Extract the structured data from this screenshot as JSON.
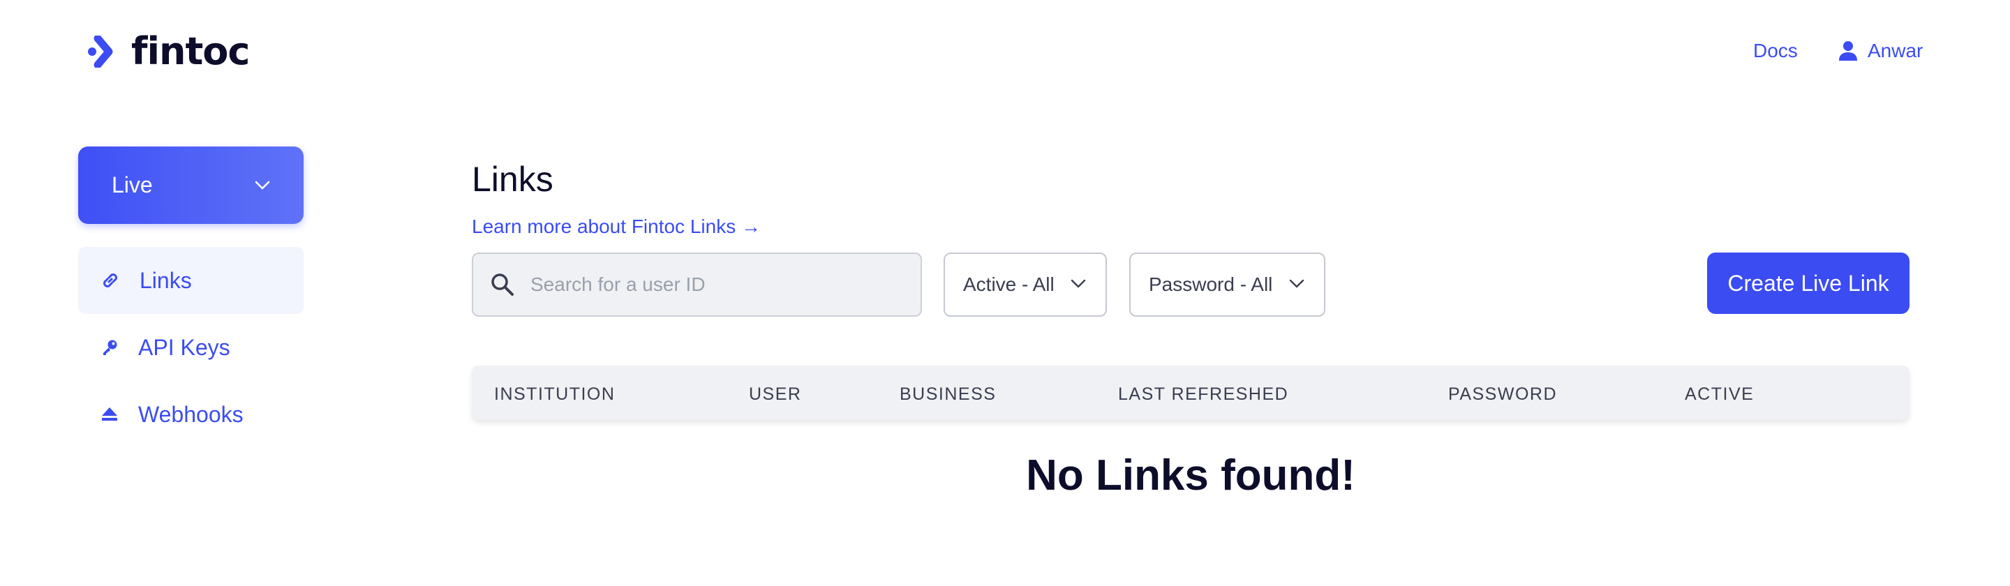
{
  "header": {
    "brand": "fintoc",
    "docs_label": "Docs",
    "user_name": "Anwar"
  },
  "sidebar": {
    "environment": "Live",
    "items": [
      {
        "label": "Links",
        "icon": "link-icon",
        "active": true
      },
      {
        "label": "API Keys",
        "icon": "key-icon",
        "active": false
      },
      {
        "label": "Webhooks",
        "icon": "eject-icon",
        "active": false
      }
    ]
  },
  "main": {
    "title": "Links",
    "learn_more": "Learn more about Fintoc Links →",
    "search": {
      "value": "",
      "placeholder": "Search for a user ID"
    },
    "filters": {
      "active": "Active - All",
      "password": "Password - All"
    },
    "create_button": "Create Live Link",
    "table": {
      "columns": [
        "INSTITUTION",
        "USER",
        "BUSINESS",
        "LAST REFRESHED",
        "PASSWORD",
        "ACTIVE"
      ],
      "rows": []
    },
    "empty_message": "No Links found!"
  },
  "colors": {
    "accent": "#3b4cf2",
    "text_dark": "#0d0d2b",
    "table_header_bg": "#f0f1f4"
  }
}
